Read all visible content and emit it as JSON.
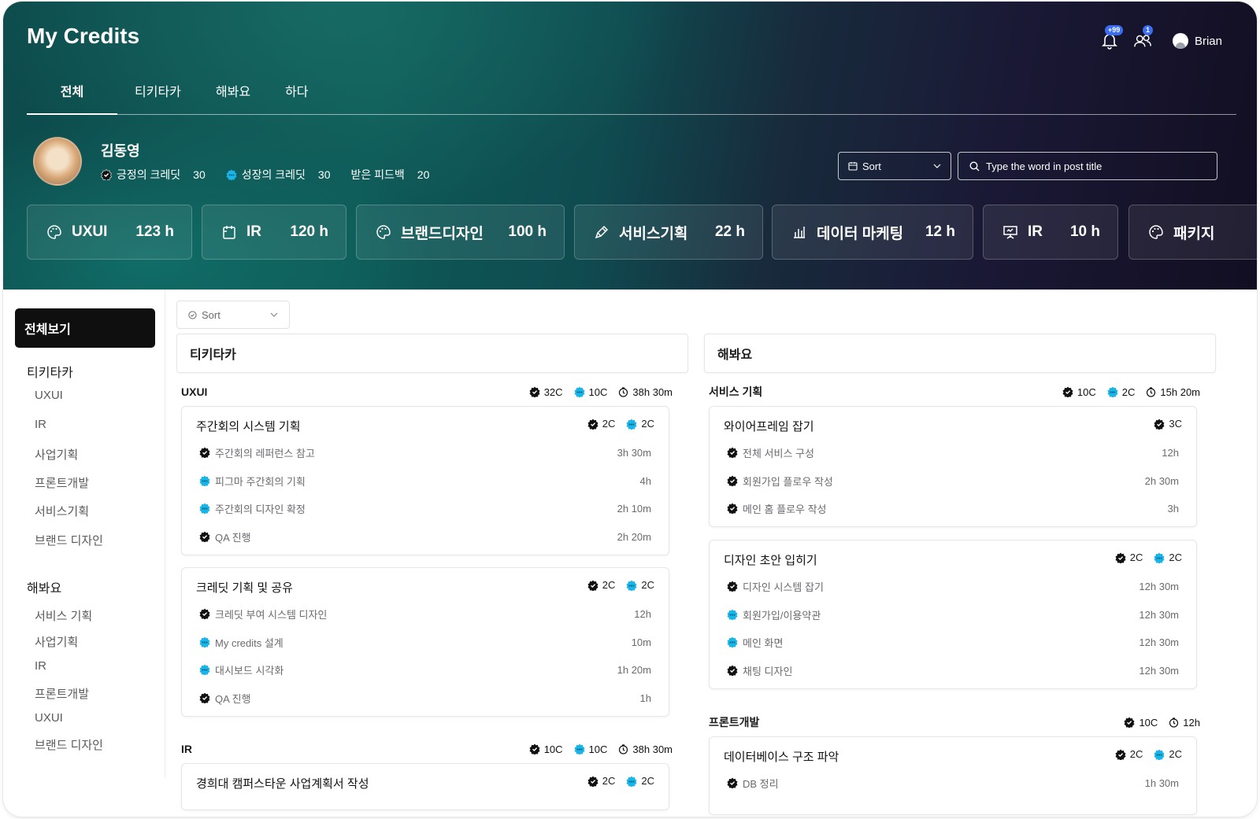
{
  "app": {
    "title": "My Credits"
  },
  "header": {
    "notifications_badge": "+99",
    "friends_badge": "1",
    "user_name": "Brian"
  },
  "tabs": [
    {
      "label": "전체",
      "active": true
    },
    {
      "label": "티키타카"
    },
    {
      "label": "해봐요"
    },
    {
      "label": "하다"
    }
  ],
  "profile": {
    "name": "김동영",
    "stats": [
      {
        "label": "긍정의 크레딧",
        "value": "30"
      },
      {
        "label": "성장의 크레딧",
        "value": "30"
      },
      {
        "label": "받은 피드백",
        "value": "20"
      }
    ]
  },
  "controls": {
    "sort_label": "Sort",
    "search_placeholder": "Type the word in post title"
  },
  "categories": [
    {
      "name": "UXUI",
      "hours": "123 h",
      "icon": "palette-icon"
    },
    {
      "name": "IR",
      "hours": "120 h",
      "icon": "clipboard-icon"
    },
    {
      "name": "브랜드디자인",
      "hours": "100 h",
      "icon": "palette-icon"
    },
    {
      "name": "서비스기획",
      "hours": "22 h",
      "icon": "pen-icon"
    },
    {
      "name": "데이터 마케팅",
      "hours": "12 h",
      "icon": "bar-chart-icon"
    },
    {
      "name": "IR",
      "hours": "10 h",
      "icon": "presentation-icon"
    },
    {
      "name": "패키지",
      "hours": "",
      "icon": "palette-icon"
    }
  ],
  "sidebar": {
    "all_label": "전체보기",
    "groups": [
      {
        "title": "티키타카",
        "items": [
          "UXUI",
          "IR",
          "사업기획",
          "프론트개발",
          "서비스기획",
          "브랜드 디자인"
        ]
      },
      {
        "title": "해봐요",
        "items": [
          "서비스 기획",
          "사업기획",
          "IR",
          "프론트개발",
          "UXUI",
          "브랜드 디자인"
        ]
      }
    ]
  },
  "content": {
    "sort_label": "Sort",
    "columns": [
      {
        "title": "티키타카",
        "sections": [
          {
            "title": "UXUI",
            "pos_credit": "32C",
            "grow_credit": "10C",
            "time": "38h 30m",
            "cards": [
              {
                "title": "주간회의 시스템 기획",
                "pos": "2C",
                "grow": "2C",
                "rows": [
                  {
                    "type": "pos",
                    "label": "주간회의 레퍼런스 참고",
                    "value": "3h 30m"
                  },
                  {
                    "type": "grow",
                    "label": "피그마 주간회의 기획",
                    "value": "4h"
                  },
                  {
                    "type": "grow",
                    "label": "주간회의 디자인 확정",
                    "value": "2h 10m"
                  },
                  {
                    "type": "pos",
                    "label": "QA 진행",
                    "value": "2h 20m"
                  }
                ]
              },
              {
                "title": "크레딧 기획 및 공유",
                "pos": "2C",
                "grow": "2C",
                "rows": [
                  {
                    "type": "pos",
                    "label": "크레딧 부여 시스템 디자인",
                    "value": "12h"
                  },
                  {
                    "type": "grow",
                    "label": "My credits 설계",
                    "value": "10m"
                  },
                  {
                    "type": "grow",
                    "label": "대시보드 시각화",
                    "value": "1h 20m"
                  },
                  {
                    "type": "pos",
                    "label": "QA 진행",
                    "value": "1h"
                  }
                ]
              }
            ]
          },
          {
            "title": "IR",
            "pos_credit": "10C",
            "grow_credit": "10C",
            "time": "38h 30m",
            "cards": [
              {
                "title": "경희대 캠퍼스타운 사업계획서 작성",
                "pos": "2C",
                "grow": "2C",
                "rows": []
              }
            ]
          }
        ]
      },
      {
        "title": "해봐요",
        "sections": [
          {
            "title": "서비스 기획",
            "pos_credit": "10C",
            "grow_credit": "2C",
            "time": "15h 20m",
            "cards": [
              {
                "title": "와이어프레임 잡기",
                "pos": "3C",
                "grow": "",
                "rows": [
                  {
                    "type": "pos",
                    "label": "전체 서비스 구성",
                    "value": "12h"
                  },
                  {
                    "type": "pos",
                    "label": "회원가입 플로우 작성",
                    "value": "2h 30m"
                  },
                  {
                    "type": "pos",
                    "label": "메인 홈 플로우 작성",
                    "value": "3h"
                  }
                ]
              },
              {
                "title": "디자인 초안 입히기",
                "pos": "2C",
                "grow": "2C",
                "rows": [
                  {
                    "type": "pos",
                    "label": "디자인 시스템 잡기",
                    "value": "12h 30m"
                  },
                  {
                    "type": "grow",
                    "label": "회원가입/이용약관",
                    "value": "12h 30m"
                  },
                  {
                    "type": "grow",
                    "label": "메인 화면",
                    "value": "12h 30m"
                  },
                  {
                    "type": "pos",
                    "label": "채팅 디자인",
                    "value": "12h 30m"
                  }
                ]
              }
            ]
          },
          {
            "title": "프론트개발",
            "pos_credit": "10C",
            "grow_credit": "",
            "time": "12h",
            "cards": [
              {
                "title": "데이터베이스 구조 파악",
                "pos": "2C",
                "grow": "2C",
                "rows": [
                  {
                    "type": "pos",
                    "label": "DB 정리",
                    "value": "1h 30m"
                  }
                ]
              }
            ]
          }
        ]
      }
    ]
  },
  "colors": {
    "positive": "#111111",
    "growth": "#19b4e8",
    "accent_badge": "#3b6df2"
  }
}
